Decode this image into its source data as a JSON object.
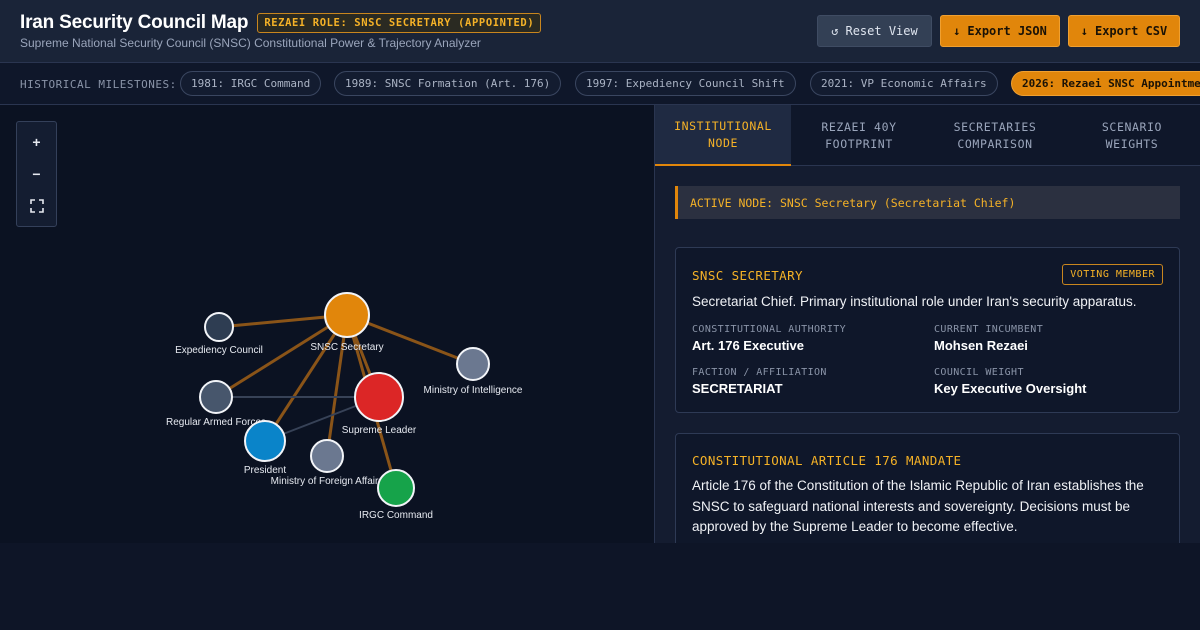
{
  "header": {
    "title": "Iran Security Council Map",
    "role_badge": "REZAEI ROLE: SNSC SECRETARY (APPOINTED)",
    "subtitle": "Supreme National Security Council (SNSC) Constitutional Power & Trajectory Analyzer",
    "reset_icon": "reset-icon",
    "reset_label": "Reset View",
    "export_icon": "download-arrow-icon",
    "export_json_label": "Export JSON",
    "export_csv_label": "Export CSV"
  },
  "milestones": {
    "label": "HISTORICAL MILESTONES:",
    "items": [
      {
        "label": "1981: IRGC Command",
        "active": false
      },
      {
        "label": "1989: SNSC Formation (Art. 176)",
        "active": false
      },
      {
        "label": "1997: Expediency Council Shift",
        "active": false
      },
      {
        "label": "2021: VP Economic Affairs",
        "active": false
      },
      {
        "label": "2026: Rezaei SNSC Appointment",
        "active": true
      }
    ]
  },
  "map": {
    "zoom_in": "+",
    "zoom_out": "−",
    "nodes": [
      {
        "id": "snsc",
        "label": "SNSC Secretary",
        "color": "#e1860b"
      },
      {
        "id": "expediency",
        "label": "Expediency Council",
        "color": "#2e3d52"
      },
      {
        "id": "intelligence",
        "label": "Ministry of Intelligence",
        "color": "#6b7890"
      },
      {
        "id": "army",
        "label": "Regular Armed Forces",
        "color": "#47566c"
      },
      {
        "id": "leader",
        "label": "Supreme Leader",
        "color": "#dc2626"
      },
      {
        "id": "president",
        "label": "President",
        "color": "#0a84c9"
      },
      {
        "id": "foreign",
        "label": "Ministry of Foreign Affairs",
        "color": "#6b7890"
      },
      {
        "id": "irgc",
        "label": "IRGC Command",
        "color": "#16a34a"
      }
    ],
    "edges": [
      {
        "from": "snsc",
        "to": "expediency",
        "kind": "primary"
      },
      {
        "from": "snsc",
        "to": "intelligence",
        "kind": "primary"
      },
      {
        "from": "snsc",
        "to": "army",
        "kind": "primary"
      },
      {
        "from": "snsc",
        "to": "president",
        "kind": "primary"
      },
      {
        "from": "snsc",
        "to": "foreign",
        "kind": "primary"
      },
      {
        "from": "snsc",
        "to": "leader",
        "kind": "primary"
      },
      {
        "from": "snsc",
        "to": "irgc",
        "kind": "primary"
      },
      {
        "from": "army",
        "to": "leader",
        "kind": "secondary"
      },
      {
        "from": "president",
        "to": "leader",
        "kind": "secondary"
      }
    ],
    "colors": {
      "primary_edge": "#8a5418",
      "secondary_edge": "#374257"
    }
  },
  "tabs": [
    {
      "label": "INSTITUTIONAL NODE",
      "active": true
    },
    {
      "label": "REZAEI 40Y FOOTPRINT",
      "active": false
    },
    {
      "label": "SECRETARIES COMPARISON",
      "active": false
    },
    {
      "label": "SCENARIO WEIGHTS",
      "active": false
    }
  ],
  "detail": {
    "active_node": "ACTIVE NODE: SNSC Secretary (Secretariat Chief)",
    "card": {
      "title": "SNSC SECRETARY",
      "badge": "VOTING MEMBER",
      "description": "Secretariat Chief. Primary institutional role under Iran's security apparatus.",
      "fields": [
        {
          "label": "CONSTITUTIONAL AUTHORITY",
          "value": "Art. 176 Executive"
        },
        {
          "label": "CURRENT INCUMBENT",
          "value": "Mohsen Rezaei"
        },
        {
          "label": "FACTION / AFFILIATION",
          "value": "SECRETARIAT"
        },
        {
          "label": "COUNCIL WEIGHT",
          "value": "Key Executive Oversight"
        }
      ]
    },
    "mandate": {
      "title": "CONSTITUTIONAL ARTICLE 176 MANDATE",
      "body": "Article 176 of the Constitution of the Islamic Republic of Iran establishes the SNSC to safeguard national interests and sovereignty. Decisions must be approved by the Supreme Leader to become effective."
    }
  },
  "colors": {
    "accent": "#e1860b",
    "accent_text": "#f5b227",
    "background": "#0e1527",
    "panel": "#141c30"
  }
}
